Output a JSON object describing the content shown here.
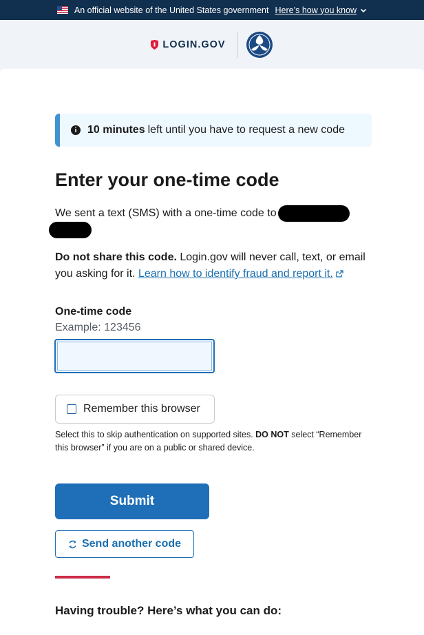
{
  "gov_banner": {
    "text": "An official website of the United States government",
    "link": "Here’s how you know"
  },
  "header": {
    "logo_text": "LOGIN.GOV"
  },
  "alert": {
    "strong": "10 minutes",
    "text": "left until you have to request a new code"
  },
  "main": {
    "heading": "Enter your one-time code",
    "sent_text": "We sent a text (SMS) with a one-time code to",
    "notice_strong": "Do not share this code.",
    "notice_text": "Login.gov will never call, text, or email you asking for it.",
    "notice_link": "Learn how to identify fraud and report it."
  },
  "form": {
    "code_label": "One-time code",
    "code_hint": "Example: 123456",
    "code_value": "",
    "remember_label": "Remember this browser",
    "remember_checked": false,
    "remember_help_1": "Select this to skip authentication on supported sites.",
    "remember_help_strong": "DO NOT",
    "remember_help_2": "select “Remember this browser” if you are on a public or shared device.",
    "submit_label": "Submit",
    "resend_label": "Send another code"
  },
  "footer": {
    "trouble_heading": "Having trouble? Here’s what you can do:"
  },
  "colors": {
    "banner_bg": "#112f4e",
    "primary": "#1f6fb8",
    "accent_rule": "#cd2c48",
    "alert_bg": "#eef8ff"
  }
}
